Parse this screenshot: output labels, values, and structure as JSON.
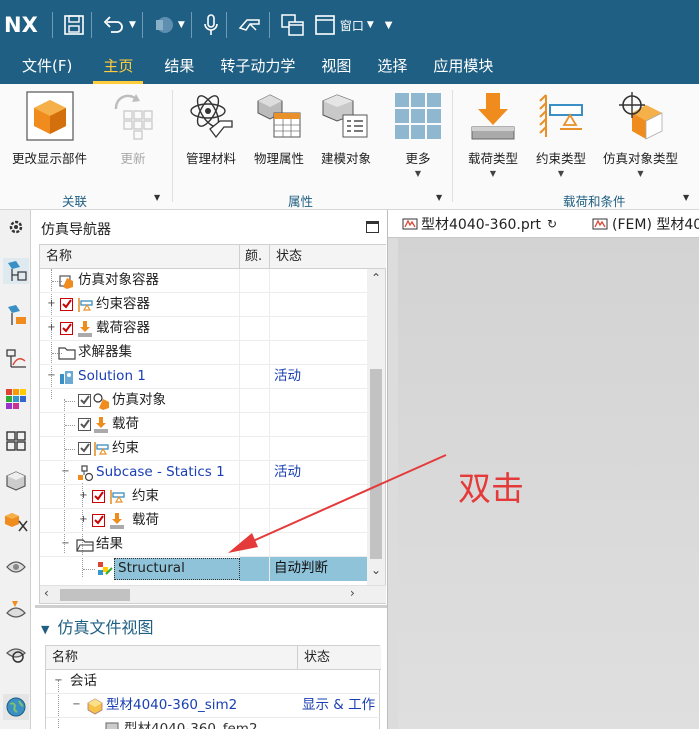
{
  "app": {
    "logo": "NX",
    "window_menu_label": "窗口"
  },
  "menu": {
    "items": [
      "文件(F)",
      "主页",
      "结果",
      "转子动力学",
      "视图",
      "选择",
      "应用模块"
    ],
    "active_index": 1
  },
  "ribbon": {
    "buttons": [
      {
        "label": "更改显示部件",
        "disabled": false
      },
      {
        "label": "更新",
        "disabled": true
      },
      {
        "label": "管理材料",
        "disabled": false
      },
      {
        "label": "物理属性",
        "disabled": false
      },
      {
        "label": "建模对象",
        "disabled": false
      },
      {
        "label": "更多",
        "disabled": false
      },
      {
        "label": "载荷类型",
        "disabled": false
      },
      {
        "label": "约束类型",
        "disabled": false
      },
      {
        "label": "仿真对象类型",
        "disabled": false
      }
    ],
    "groups": [
      "关联",
      "属性",
      "载荷和条件"
    ]
  },
  "navigator": {
    "title": "仿真导航器",
    "columns": [
      "名称",
      "颜.",
      "状态"
    ],
    "rows": [
      {
        "label": "仿真对象容器",
        "status": ""
      },
      {
        "label": "约束容器",
        "status": ""
      },
      {
        "label": "载荷容器",
        "status": ""
      },
      {
        "label": "求解器集",
        "status": ""
      },
      {
        "label": "Solution 1",
        "status": "活动"
      },
      {
        "label": "仿真对象",
        "status": ""
      },
      {
        "label": "载荷",
        "status": ""
      },
      {
        "label": "约束",
        "status": ""
      },
      {
        "label": "Subcase - Statics 1",
        "status": "活动"
      },
      {
        "label": "约束",
        "status": ""
      },
      {
        "label": "载荷",
        "status": ""
      },
      {
        "label": "结果",
        "status": ""
      },
      {
        "label": "Structural",
        "status": "自动判断"
      }
    ]
  },
  "file_view": {
    "title": "仿真文件视图",
    "columns": [
      "名称",
      "状态"
    ],
    "rows": [
      {
        "label": "会话",
        "status": ""
      },
      {
        "label": "型材4040-360_sim2",
        "status": "显示 & 工作"
      },
      {
        "label": "型材4040-360_fem2",
        "status": ""
      }
    ]
  },
  "tabs": [
    {
      "label": "型材4040-360.prt"
    },
    {
      "label": "(FEM) 型材4040"
    }
  ],
  "annotation": "双击",
  "colors": {
    "title_bg": "#1f5f83",
    "active_menu": "#ffcd3c",
    "link_blue": "#1a3fb3",
    "annotation_red": "#e43a3a",
    "selection": "#8ec3d9"
  }
}
